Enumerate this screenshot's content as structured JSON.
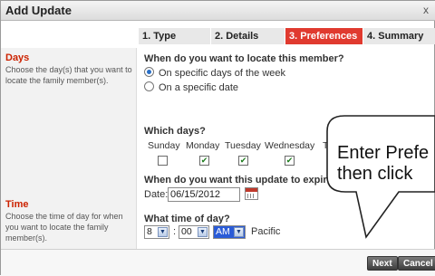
{
  "dialog": {
    "title": "Add Update",
    "close_glyph": "x"
  },
  "tabs": [
    {
      "label": "1. Type",
      "active": false
    },
    {
      "label": "2. Details",
      "active": false
    },
    {
      "label": "3. Preferences",
      "active": true
    },
    {
      "label": "4. Summary",
      "active": false
    }
  ],
  "sidebar": {
    "days_heading": "Days",
    "days_help": "Choose the day(s) that you want to locate the family member(s).",
    "time_heading": "Time",
    "time_help": "Choose the time of day for when you want to locate the family member(s)."
  },
  "form": {
    "locate_question": "When do you want to locate this member?",
    "option_specific_days": "On specific days of the week",
    "option_specific_date": "On a specific date",
    "selected_option": "specific_days",
    "which_days_label": "Which days?",
    "days": [
      {
        "label": "Sunday",
        "checked": false
      },
      {
        "label": "Monday",
        "checked": true
      },
      {
        "label": "Tuesday",
        "checked": true
      },
      {
        "label": "Wednesday",
        "checked": true
      },
      {
        "label": "T",
        "checked": false
      }
    ],
    "expire_question": "When do you want this update to expire?",
    "date_label": "Date:",
    "date_value": "06/15/2012",
    "time_question": "What time of day?",
    "hour": "8",
    "minute": "00",
    "ampm": "AM",
    "timezone": "Pacific",
    "time_separator": ":"
  },
  "footer": {
    "next_label": "Next",
    "cancel_label": "Cancel"
  },
  "callout": {
    "line1": "Enter Prefe",
    "line2": "then click"
  },
  "icons": {
    "calendar": "calendar-icon",
    "dropdown": "chevron-down-icon",
    "close": "close-icon"
  },
  "colors": {
    "accent_tab": "#e03a2f",
    "sidebar_heading": "#cc2200"
  }
}
